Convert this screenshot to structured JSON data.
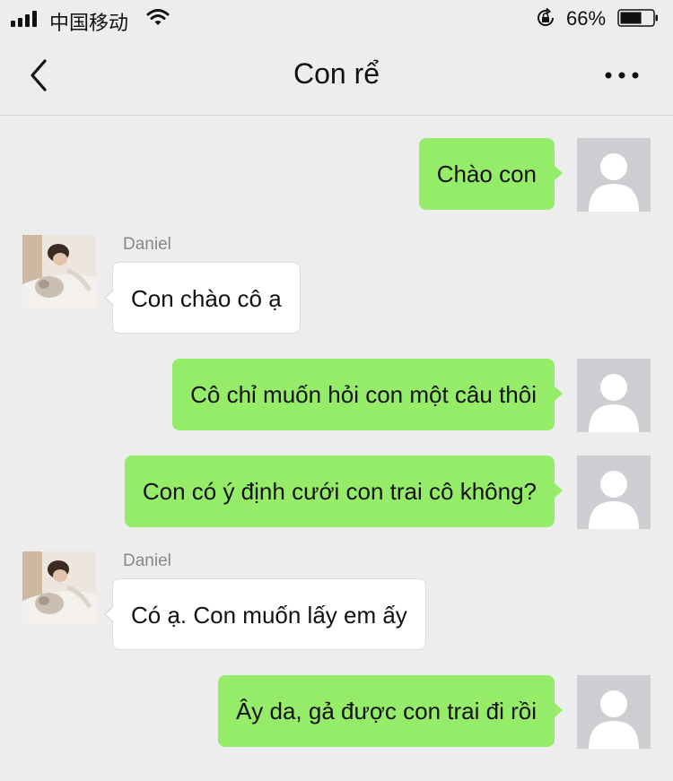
{
  "status_bar": {
    "carrier": "中国移动",
    "battery_percent": "66%",
    "battery_level": 0.66,
    "icons": [
      "signal-icon",
      "wifi-icon",
      "rotation-lock-icon",
      "battery-icon"
    ]
  },
  "nav": {
    "title": "Con rể",
    "back_icon": "chevron-left-icon",
    "more_icon": "more-dots-icon"
  },
  "colors": {
    "background": "#ededed",
    "outgoing_bubble": "#95ec69",
    "incoming_bubble": "#ffffff",
    "sender_name": "#888888",
    "default_avatar": "#cdcdd2"
  },
  "messages": [
    {
      "direction": "outgoing",
      "text": "Chào con"
    },
    {
      "direction": "incoming",
      "sender": "Daniel",
      "text": "Con chào cô ạ"
    },
    {
      "direction": "outgoing",
      "text": "Cô chỉ muốn hỏi con một câu thôi"
    },
    {
      "direction": "outgoing",
      "text": "Con có ý định cưới con trai cô không?"
    },
    {
      "direction": "incoming",
      "sender": "Daniel",
      "text": "Có ạ. Con muốn lấy em ấy"
    },
    {
      "direction": "outgoing",
      "text": "Ây da, gả được con trai đi rồi"
    }
  ]
}
